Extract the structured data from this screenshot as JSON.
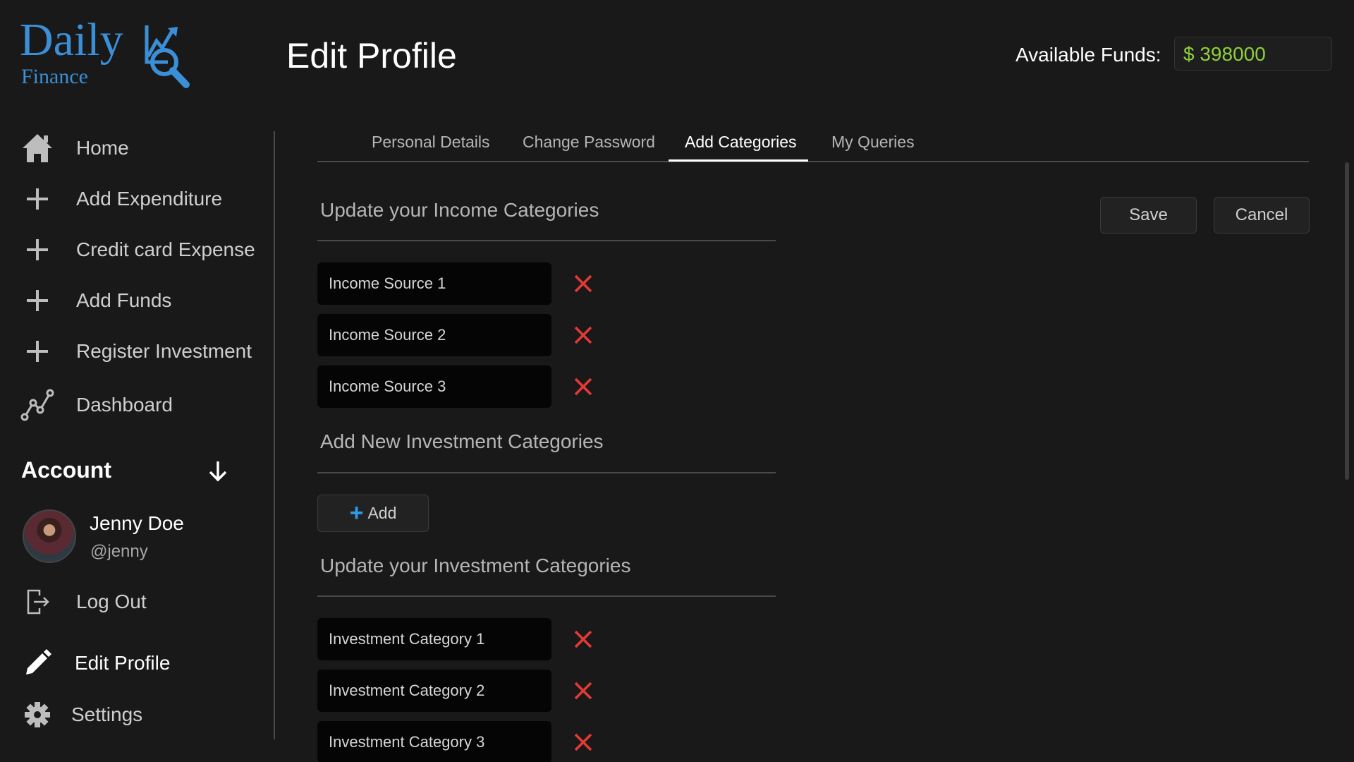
{
  "logo": {
    "line1": "Daily",
    "line2": "Finance"
  },
  "header": {
    "title": "Edit Profile",
    "funds_label": "Available Funds:",
    "funds_value": "$ 398000",
    "funds_color": "#8fcf3c"
  },
  "sidebar": {
    "items": [
      {
        "label": "Home",
        "icon": "home-icon"
      },
      {
        "label": "Add Expenditure",
        "icon": "plus-icon"
      },
      {
        "label": "Credit card Expense",
        "icon": "plus-icon"
      },
      {
        "label": "Add Funds",
        "icon": "plus-icon"
      },
      {
        "label": "Register Investment",
        "icon": "plus-icon"
      },
      {
        "label": "Dashboard",
        "icon": "chart-line-icon"
      }
    ],
    "account": {
      "title": "Account",
      "user_name": "Jenny Doe",
      "user_handle": "@jenny",
      "logout": "Log Out",
      "edit_profile": "Edit Profile",
      "settings": "Settings"
    }
  },
  "tabs": {
    "items": [
      "Personal Details",
      "Change Password",
      "Add Categories",
      "My Queries"
    ],
    "active": "Add Categories"
  },
  "income": {
    "title": "Update your Income Categories",
    "items": [
      "Income Source 1",
      "Income Source 2",
      "Income Source 3"
    ]
  },
  "new_investment": {
    "title": "Add New Investment Categories",
    "add_label": "Add"
  },
  "investment": {
    "title": "Update your Investment Categories",
    "items": [
      "Investment Category 1",
      "Investment Category 2",
      "Investment Category 3"
    ]
  },
  "actions": {
    "save": "Save",
    "cancel": "Cancel"
  },
  "colors": {
    "accent": "#2e9bea",
    "delete": "#e53935",
    "logo": "#3a8fd6"
  }
}
